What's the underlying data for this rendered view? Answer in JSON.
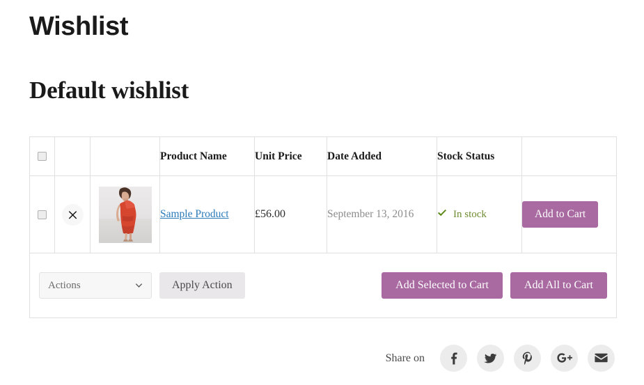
{
  "page": {
    "title": "Wishlist",
    "wishlist_name": "Default wishlist"
  },
  "table": {
    "headers": {
      "select_all": "",
      "remove": "",
      "thumbnail": "",
      "product_name": "Product Name",
      "unit_price": "Unit Price",
      "date_added": "Date Added",
      "stock_status": "Stock Status",
      "action": ""
    },
    "rows": [
      {
        "selected": false,
        "remove_label": "×",
        "thumbnail_alt": "red one-shoulder midi dress",
        "product_name": "Sample Product",
        "unit_price": "£56.00",
        "date_added": "September 13, 2016",
        "stock_status": "In stock",
        "stock_icon": "check-icon",
        "add_to_cart_label": "Add to Cart"
      }
    ]
  },
  "toolbar": {
    "actions_select_value": "Actions",
    "actions_select_icon": "chevron-down-icon",
    "apply_action_label": "Apply Action",
    "add_selected_label": "Add Selected to Cart",
    "add_all_label": "Add All to Cart"
  },
  "share": {
    "label": "Share on",
    "items": [
      {
        "name": "facebook",
        "icon": "facebook-icon"
      },
      {
        "name": "twitter",
        "icon": "twitter-icon"
      },
      {
        "name": "pinterest",
        "icon": "pinterest-icon"
      },
      {
        "name": "googleplus",
        "icon": "google-plus-icon"
      },
      {
        "name": "email",
        "icon": "envelope-icon"
      }
    ]
  },
  "colors": {
    "accent_purple": "#a86aa0",
    "link_blue": "#2a7ab9",
    "stock_green": "#6f8b33",
    "grey_button": "#e9e7e9",
    "border": "#e0e0e0"
  }
}
